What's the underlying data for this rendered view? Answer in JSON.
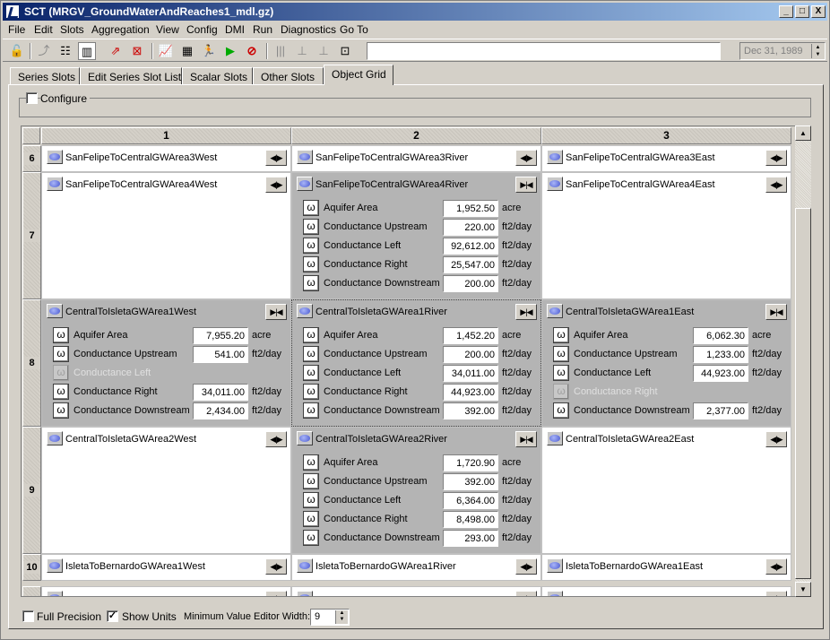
{
  "window": {
    "title": "SCT  (MRGV_GroundWaterAndReaches1_mdl.gz)",
    "controls": [
      "_",
      "□",
      "X"
    ]
  },
  "menu": [
    "File",
    "Edit",
    "Slots",
    "Aggregation",
    "View",
    "Config",
    "DMI",
    "Run",
    "Diagnostics",
    "Go To"
  ],
  "toolbar": {
    "icons": [
      "lock-icon",
      "link-icon",
      "filter-icon",
      "column-icon",
      "open-object-icon",
      "close-object-icon",
      "plot-icon",
      "calculator-icon",
      "run-person-icon",
      "play-icon",
      "stop-icon",
      "grid-lines-icon",
      "align-left-icon",
      "align-right-icon",
      "fit-icon"
    ],
    "search_value": "",
    "date": "Dec 31, 1989"
  },
  "tabs": [
    {
      "label": "Series Slots",
      "active": false
    },
    {
      "label": "Edit Series Slot List",
      "active": false
    },
    {
      "label": "Scalar Slots",
      "active": false
    },
    {
      "label": "Other Slots",
      "active": false
    },
    {
      "label": "Object Grid",
      "active": true
    }
  ],
  "configure": {
    "label": "Configure",
    "checked": false
  },
  "grid": {
    "columns": [
      "1",
      "2",
      "3"
    ],
    "rows": [
      {
        "label": "6",
        "cells": [
          {
            "name": "SanFelipeToCentralGWArea3West",
            "slots": []
          },
          {
            "name": "SanFelipeToCentralGWArea3River",
            "slots": []
          },
          {
            "name": "SanFelipeToCentralGWArea3East",
            "slots": []
          }
        ]
      },
      {
        "label": "7",
        "cells": [
          {
            "name": "SanFelipeToCentralGWArea4West",
            "slots": []
          },
          {
            "name": "SanFelipeToCentralGWArea4River",
            "slots": [
              {
                "label": "Aquifer Area",
                "value": "1,952.50",
                "unit": "acre"
              },
              {
                "label": "Conductance Upstream",
                "value": "220.00",
                "unit": "ft2/day"
              },
              {
                "label": "Conductance Left",
                "value": "92,612.00",
                "unit": "ft2/day"
              },
              {
                "label": "Conductance Right",
                "value": "25,547.00",
                "unit": "ft2/day"
              },
              {
                "label": "Conductance Downstream",
                "value": "200.00",
                "unit": "ft2/day"
              }
            ]
          },
          {
            "name": "SanFelipeToCentralGWArea4East",
            "slots": []
          }
        ]
      },
      {
        "label": "8",
        "cells": [
          {
            "name": "CentralToIsletaGWArea1West",
            "slots": [
              {
                "label": "Aquifer Area",
                "value": "7,955.20",
                "unit": "acre"
              },
              {
                "label": "Conductance Upstream",
                "value": "541.00",
                "unit": "ft2/day"
              },
              {
                "label": "Conductance Left",
                "value": "",
                "unit": "",
                "disabled": true
              },
              {
                "label": "Conductance Right",
                "value": "34,011.00",
                "unit": "ft2/day"
              },
              {
                "label": "Conductance Downstream",
                "value": "2,434.00",
                "unit": "ft2/day"
              }
            ]
          },
          {
            "name": "CentralToIsletaGWArea1River",
            "slots": [
              {
                "label": "Aquifer Area",
                "value": "1,452.20",
                "unit": "acre"
              },
              {
                "label": "Conductance Upstream",
                "value": "200.00",
                "unit": "ft2/day"
              },
              {
                "label": "Conductance Left",
                "value": "34,011.00",
                "unit": "ft2/day"
              },
              {
                "label": "Conductance Right",
                "value": "44,923.00",
                "unit": "ft2/day"
              },
              {
                "label": "Conductance Downstream",
                "value": "392.00",
                "unit": "ft2/day"
              }
            ]
          },
          {
            "name": "CentralToIsletaGWArea1East",
            "slots": [
              {
                "label": "Aquifer Area",
                "value": "6,062.30",
                "unit": "acre"
              },
              {
                "label": "Conductance Upstream",
                "value": "1,233.00",
                "unit": "ft2/day"
              },
              {
                "label": "Conductance Left",
                "value": "44,923.00",
                "unit": "ft2/day"
              },
              {
                "label": "Conductance Right",
                "value": "",
                "unit": "",
                "disabled": true
              },
              {
                "label": "Conductance Downstream",
                "value": "2,377.00",
                "unit": "ft2/day"
              }
            ]
          }
        ]
      },
      {
        "label": "9",
        "cells": [
          {
            "name": "CentralToIsletaGWArea2West",
            "slots": []
          },
          {
            "name": "CentralToIsletaGWArea2River",
            "slots": [
              {
                "label": "Aquifer Area",
                "value": "1,720.90",
                "unit": "acre"
              },
              {
                "label": "Conductance Upstream",
                "value": "392.00",
                "unit": "ft2/day"
              },
              {
                "label": "Conductance Left",
                "value": "6,364.00",
                "unit": "ft2/day"
              },
              {
                "label": "Conductance Right",
                "value": "8,498.00",
                "unit": "ft2/day"
              },
              {
                "label": "Conductance Downstream",
                "value": "293.00",
                "unit": "ft2/day"
              }
            ]
          },
          {
            "name": "CentralToIsletaGWArea2East",
            "slots": []
          }
        ]
      },
      {
        "label": "10",
        "cells": [
          {
            "name": "IsletaToBernardoGWArea1West",
            "slots": []
          },
          {
            "name": "IsletaToBernardoGWArea1River",
            "slots": []
          },
          {
            "name": "IsletaToBernardoGWArea1East",
            "slots": []
          }
        ]
      }
    ]
  },
  "bottom": {
    "full_precision": {
      "label": "Full Precision",
      "checked": false
    },
    "show_units": {
      "label": "Show Units",
      "checked": true
    },
    "min_width_label": "Minimum Value Editor Width:",
    "min_width_value": "9"
  },
  "glyphs": {
    "check": "✓",
    "slot_icon": "ω",
    "expanded_toggle": "▶|◀",
    "collapsed_toggle": "◀|▶",
    "up": "▲",
    "down": "▼"
  }
}
